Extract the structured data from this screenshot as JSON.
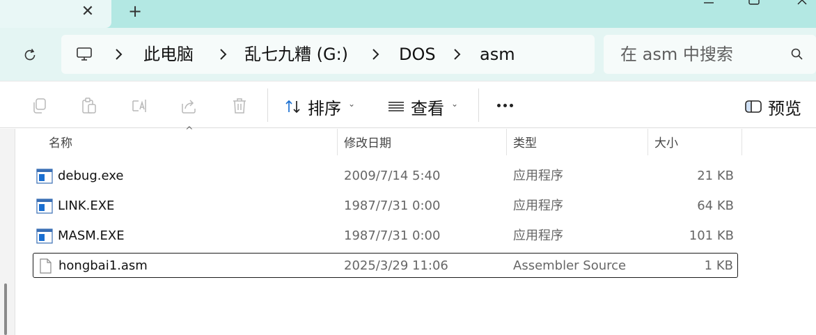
{
  "tab": {
    "close_glyph": "✕",
    "new_tab_glyph": "+"
  },
  "window": {
    "min_icon": "minimize-icon",
    "max_icon": "maximize-icon",
    "close_icon": "close-icon"
  },
  "address": {
    "refresh_icon": "refresh-icon",
    "root_icon": "computer-icon",
    "crumbs": [
      "此电脑",
      "乱七九糟 (G:)",
      "DOS",
      "asm"
    ]
  },
  "search": {
    "placeholder": "在 asm 中搜索",
    "icon": "search-icon"
  },
  "toolbar": {
    "icons": [
      "copy-icon",
      "paste-icon",
      "rename-icon",
      "share-icon",
      "delete-icon"
    ],
    "sort_label": "排序",
    "view_label": "查看",
    "more_icon": "more-icon",
    "preview_label": "预览"
  },
  "columns": {
    "name": "名称",
    "modified": "修改日期",
    "type": "类型",
    "size": "大小"
  },
  "files": [
    {
      "name": "debug.exe",
      "modified": "2009/7/14 5:40",
      "type": "应用程序",
      "size": "21 KB",
      "icon": "executable-icon"
    },
    {
      "name": "LINK.EXE",
      "modified": "1987/7/31 0:00",
      "type": "应用程序",
      "size": "64 KB",
      "icon": "executable-icon"
    },
    {
      "name": "MASM.EXE",
      "modified": "1987/7/31 0:00",
      "type": "应用程序",
      "size": "101 KB",
      "icon": "executable-icon"
    },
    {
      "name": "hongbai1.asm",
      "modified": "2025/3/29 11:06",
      "type": "Assembler Source",
      "size": "1 KB",
      "icon": "file-icon"
    }
  ],
  "colors": {
    "titlebar": "#b3e8e3",
    "addressbar": "#e4f5f3",
    "accent": "#1a6fd1"
  }
}
